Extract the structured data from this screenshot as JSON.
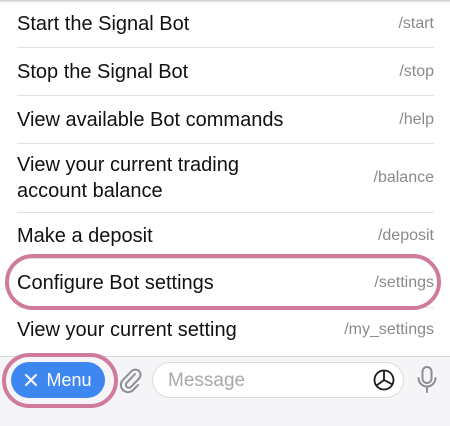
{
  "commands": [
    {
      "description_lines": [
        "Start the Signal Bot"
      ],
      "command": "/start"
    },
    {
      "description_lines": [
        "Stop the Signal Bot"
      ],
      "command": "/stop"
    },
    {
      "description_lines": [
        "View available Bot commands"
      ],
      "command": "/help"
    },
    {
      "description_lines": [
        "View your current trading",
        "account balance"
      ],
      "command": "/balance"
    },
    {
      "description_lines": [
        "Make a deposit"
      ],
      "command": "/deposit"
    },
    {
      "description_lines": [
        "Configure Bot settings"
      ],
      "command": "/settings"
    },
    {
      "description_lines": [
        "View your current setting"
      ],
      "command": "/my_settings"
    }
  ],
  "highlighted_command": "/settings",
  "input_bar": {
    "menu_label": "Menu",
    "menu_icon": "close-icon",
    "attach_icon": "paperclip-icon",
    "message_placeholder": "Message",
    "sticker_icon": "sticker-icon",
    "mic_icon": "microphone-icon"
  },
  "colors": {
    "menu_button": "#3e86f0",
    "highlight_ring": "#d07a9c",
    "icon_gray": "#8e8e93"
  }
}
